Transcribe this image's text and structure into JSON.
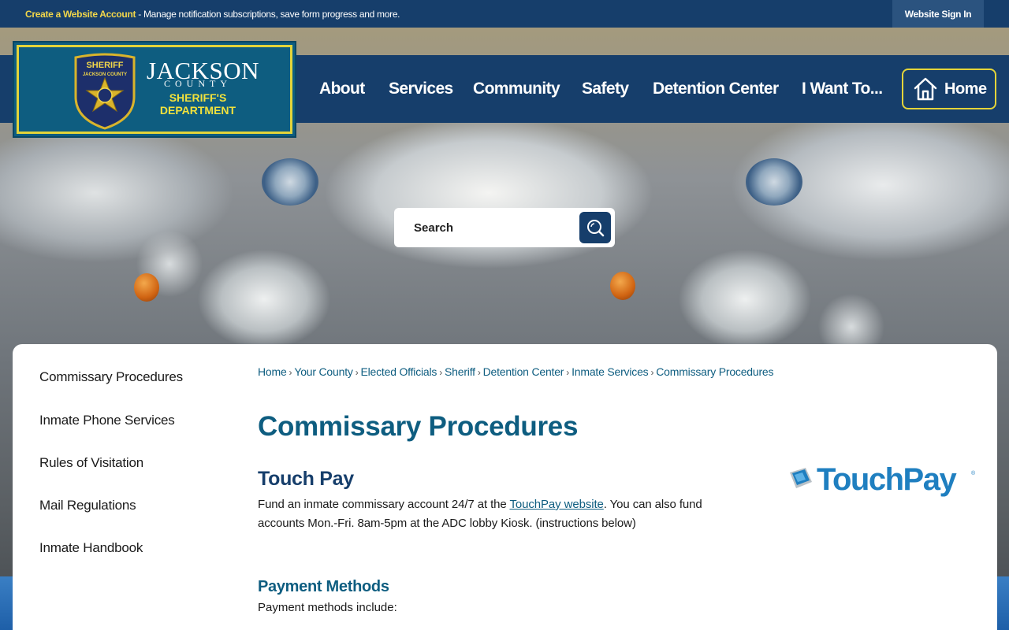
{
  "topbar": {
    "create_account": "Create a Website Account",
    "promo_text": " - Manage notification subscriptions, save form progress and more.",
    "sign_in": "Website Sign In"
  },
  "logo": {
    "badge_text": "SHERIFF",
    "badge_county": "JACKSON COUNTY",
    "jackson": "JACKSON",
    "county": "COUNTY",
    "line1": "SHERIFF'S",
    "line2": "DEPARTMENT"
  },
  "nav": {
    "items": [
      "About",
      "Services",
      "Community",
      "Safety",
      "Detention Center",
      "I Want To..."
    ],
    "home": "Home"
  },
  "search": {
    "placeholder": "Search"
  },
  "sidenav": {
    "items": [
      "Commissary Procedures",
      "Inmate Phone Services",
      "Rules of Visitation",
      "Mail Regulations",
      "Inmate Handbook"
    ]
  },
  "breadcrumb": [
    "Home",
    "Your County",
    "Elected Officials",
    "Sheriff",
    "Detention Center",
    "Inmate Services",
    "Commissary Procedures"
  ],
  "main": {
    "title": "Commissary Procedures",
    "section_title": "Touch Pay",
    "para_before": "Fund an inmate commissary account 24/7 at the ",
    "para_link": "TouchPay website",
    "para_after": ". You can also fund accounts Mon.-Fri. 8am-5pm at the ADC lobby Kiosk. (instructions below)",
    "payment_title": "Payment Methods",
    "payment_text": "Payment methods include:",
    "logo_text": "TouchPay",
    "logo_mark": "®"
  },
  "colors": {
    "navy": "#163e6b",
    "teal": "#0e5d80",
    "gold": "#e3d43a",
    "touchpay_blue": "#1f7fc0"
  }
}
